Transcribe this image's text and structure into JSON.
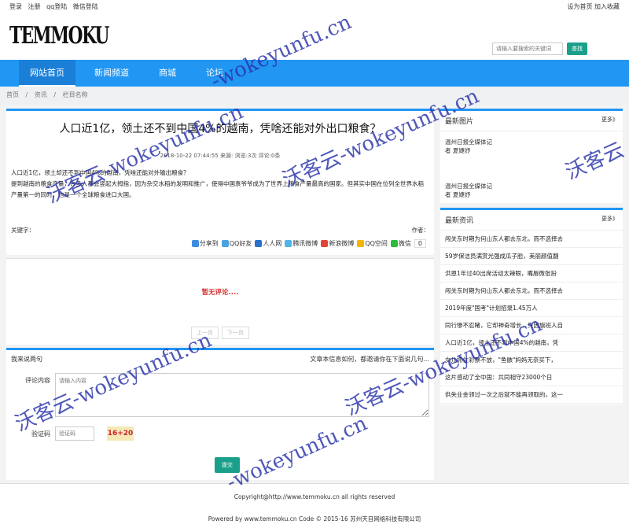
{
  "topbar": {
    "links": [
      "登录",
      "注册",
      "qq登陆",
      "微信登陆"
    ],
    "right": "设为首页 加入收藏"
  },
  "header": {
    "logo": "TEMMOKU",
    "search_placeholder": "请输入要搜索的关键词",
    "search_button": "查找"
  },
  "nav": {
    "items": [
      "网站首页",
      "新闻频道",
      "商城",
      "论坛"
    ]
  },
  "breadcrumb": [
    "首页",
    "/",
    "资讯",
    "/",
    "栏目名称"
  ],
  "article": {
    "title": "人口近1亿，领土还不到中国4%的越南，凭啥还能对外出口粮食？",
    "meta": "2018-10-22 07:44:55 来源: 浏览:3次 评论:0条",
    "paragraphs": [
      "人口近1亿，领土却还不到中国4%的越南，凭啥还能对外输出粮食？",
      "提到越南的粮食产量，许多人都会竖起大拇指，因为杂交水稻的发明和推广，使得中国袁爷爷成为了世界上粮食产量最高的国家。但其实中国在位列全世界水稻产量第一的同时，也是一个全球粮食进口大国。"
    ],
    "keywords_label": "关键字：",
    "author_label": "作者：",
    "share": [
      "分享到",
      "QQ好友",
      "人人网",
      "腾讯微博",
      "新浪微博",
      "QQ空间",
      "微信"
    ],
    "share_count": "0"
  },
  "comments": {
    "empty": "暂无评论....",
    "prev": "上一页",
    "next": "下一页"
  },
  "comment_form": {
    "title": "我来说两句",
    "notice": "文章本信息如何，都邀请你在下面说几句...",
    "content_label": "评论内容",
    "content_placeholder": "请输入内容",
    "captcha_label": "验证码",
    "captcha_placeholder": "验证码",
    "captcha_text": "16+20",
    "submit": "提交"
  },
  "sidebar": {
    "pictures": {
      "title": "最新图片",
      "more": "更多》",
      "items": [
        {
          "line1": "温州日报全媒体记",
          "line2": "者 夏婕妤"
        },
        {
          "line1": "温州日报全媒体记",
          "line2": "者 夏婕妤"
        }
      ]
    },
    "news": {
      "title": "最新资讯",
      "more": "更多》",
      "items": [
        "闯关东时期为何山东人都去东北，而不选择去",
        "59岁保洁员满赏光强成瓜子脸，美丽颜值翻",
        "洪恩1年过40出席活动太辣眼，嘴唇微张扮",
        "闯关东时期为何山东人都去东北，而不选择去",
        "2019年度\"国考\"计划招录1.45万人",
        "同行惨不忍睹，它却神奇增长，只因旗班人自",
        "人口近1亿，领土还不到中国4%的越南，凭",
        "女儿抓住彩票不放，\"鱼骸\"妈妈无奈买下，",
        "这片感动了全中国：共同相守23000个日",
        "供失业金领过一次之后就不能再领取的，这一"
      ]
    }
  },
  "footer": {
    "copyright": "Copyright@http://www.temmoku.cn all rights reserved",
    "powered": "Powered by www.temmoku.cn Code © 2015-16 苏州天目网络科技有限公司"
  },
  "watermark": {
    "cn": "沃客云",
    "en": "-wokeyunfu.cn"
  }
}
